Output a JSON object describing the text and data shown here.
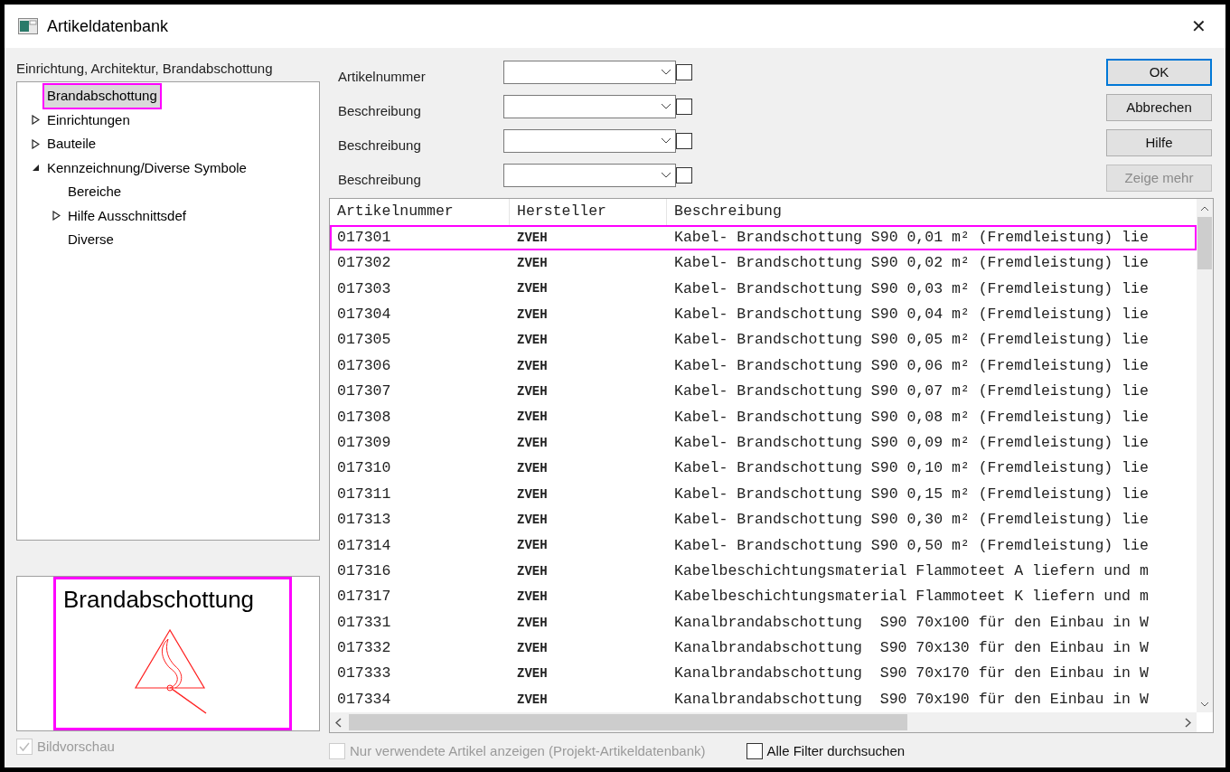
{
  "window": {
    "title": "Artikeldatenbank",
    "close": "✕"
  },
  "tree": {
    "label": "Einrichtung, Architektur, Brandabschottung",
    "items": [
      {
        "label": "Brandabschottung",
        "kind": "leaf",
        "selected": true,
        "highlighted": true
      },
      {
        "label": "Einrichtungen",
        "kind": "collapsed",
        "selected": false,
        "highlighted": false
      },
      {
        "label": "Bauteile",
        "kind": "collapsed",
        "selected": false,
        "highlighted": false
      },
      {
        "label": "Kennzeichnung/Diverse Symbole",
        "kind": "expanded",
        "selected": false,
        "highlighted": false,
        "children": [
          {
            "label": "Bereiche",
            "kind": "leaf",
            "selected": false,
            "highlighted": false
          },
          {
            "label": "Hilfe Ausschnittsdef",
            "kind": "collapsed",
            "selected": false,
            "highlighted": false
          },
          {
            "label": "Diverse",
            "kind": "leaf",
            "selected": false,
            "highlighted": false
          }
        ]
      }
    ]
  },
  "preview": {
    "title": "Brandabschottung",
    "highlighted": true
  },
  "image_preview": {
    "label": "Bildvorschau",
    "checked": true,
    "disabled": true
  },
  "filters": [
    {
      "label": "Artikelnummer",
      "checked": false
    },
    {
      "label": "Beschreibung",
      "checked": false
    },
    {
      "label": "Beschreibung",
      "checked": false
    },
    {
      "label": "Beschreibung",
      "checked": false
    }
  ],
  "buttons": [
    {
      "label": "OK",
      "default": true,
      "disabled": false
    },
    {
      "label": "Abbrechen",
      "default": false,
      "disabled": false
    },
    {
      "label": "Hilfe",
      "default": false,
      "disabled": false
    },
    {
      "label": "Zeige mehr",
      "default": false,
      "disabled": true
    }
  ],
  "table": {
    "columns": [
      "Artikelnummer",
      "Hersteller",
      "Beschreibung"
    ],
    "rows": [
      {
        "cells": [
          "017301",
          "ZVEH",
          "Kabel- Brandschottung S90 0,01 m² (Fremdleistung) lie"
        ],
        "highlighted": true
      },
      {
        "cells": [
          "017302",
          "ZVEH",
          "Kabel- Brandschottung S90 0,02 m² (Fremdleistung) lie"
        ],
        "highlighted": false
      },
      {
        "cells": [
          "017303",
          "ZVEH",
          "Kabel- Brandschottung S90 0,03 m² (Fremdleistung) lie"
        ],
        "highlighted": false
      },
      {
        "cells": [
          "017304",
          "ZVEH",
          "Kabel- Brandschottung S90 0,04 m² (Fremdleistung) lie"
        ],
        "highlighted": false
      },
      {
        "cells": [
          "017305",
          "ZVEH",
          "Kabel- Brandschottung S90 0,05 m² (Fremdleistung) lie"
        ],
        "highlighted": false
      },
      {
        "cells": [
          "017306",
          "ZVEH",
          "Kabel- Brandschottung S90 0,06 m² (Fremdleistung) lie"
        ],
        "highlighted": false
      },
      {
        "cells": [
          "017307",
          "ZVEH",
          "Kabel- Brandschottung S90 0,07 m² (Fremdleistung) lie"
        ],
        "highlighted": false
      },
      {
        "cells": [
          "017308",
          "ZVEH",
          "Kabel- Brandschottung S90 0,08 m² (Fremdleistung) lie"
        ],
        "highlighted": false
      },
      {
        "cells": [
          "017309",
          "ZVEH",
          "Kabel- Brandschottung S90 0,09 m² (Fremdleistung) lie"
        ],
        "highlighted": false
      },
      {
        "cells": [
          "017310",
          "ZVEH",
          "Kabel- Brandschottung S90 0,10 m² (Fremdleistung) lie"
        ],
        "highlighted": false
      },
      {
        "cells": [
          "017311",
          "ZVEH",
          "Kabel- Brandschottung S90 0,15 m² (Fremdleistung) lie"
        ],
        "highlighted": false
      },
      {
        "cells": [
          "017313",
          "ZVEH",
          "Kabel- Brandschottung S90 0,30 m² (Fremdleistung) lie"
        ],
        "highlighted": false
      },
      {
        "cells": [
          "017314",
          "ZVEH",
          "Kabel- Brandschottung S90 0,50 m² (Fremdleistung) lie"
        ],
        "highlighted": false
      },
      {
        "cells": [
          "017316",
          "ZVEH",
          "Kabelbeschichtungsmaterial Flammoteet A liefern und m"
        ],
        "highlighted": false
      },
      {
        "cells": [
          "017317",
          "ZVEH",
          "Kabelbeschichtungsmaterial Flammoteet K liefern und m"
        ],
        "highlighted": false
      },
      {
        "cells": [
          "017331",
          "ZVEH",
          "Kanalbrandabschottung  S90 70x100 für den Einbau in W"
        ],
        "highlighted": false
      },
      {
        "cells": [
          "017332",
          "ZVEH",
          "Kanalbrandabschottung  S90 70x130 für den Einbau in W"
        ],
        "highlighted": false
      },
      {
        "cells": [
          "017333",
          "ZVEH",
          "Kanalbrandabschottung  S90 70x170 für den Einbau in W"
        ],
        "highlighted": false
      },
      {
        "cells": [
          "017334",
          "ZVEH",
          "Kanalbrandabschottung  S90 70x190 für den Einbau in W"
        ],
        "highlighted": false
      }
    ]
  },
  "options": [
    {
      "label": "Nur verwendete Artikel anzeigen (Projekt-Artikeldatenbank)",
      "checked": false,
      "disabled": true
    },
    {
      "label": "Alle Filter durchsuchen",
      "checked": false,
      "disabled": false
    }
  ]
}
